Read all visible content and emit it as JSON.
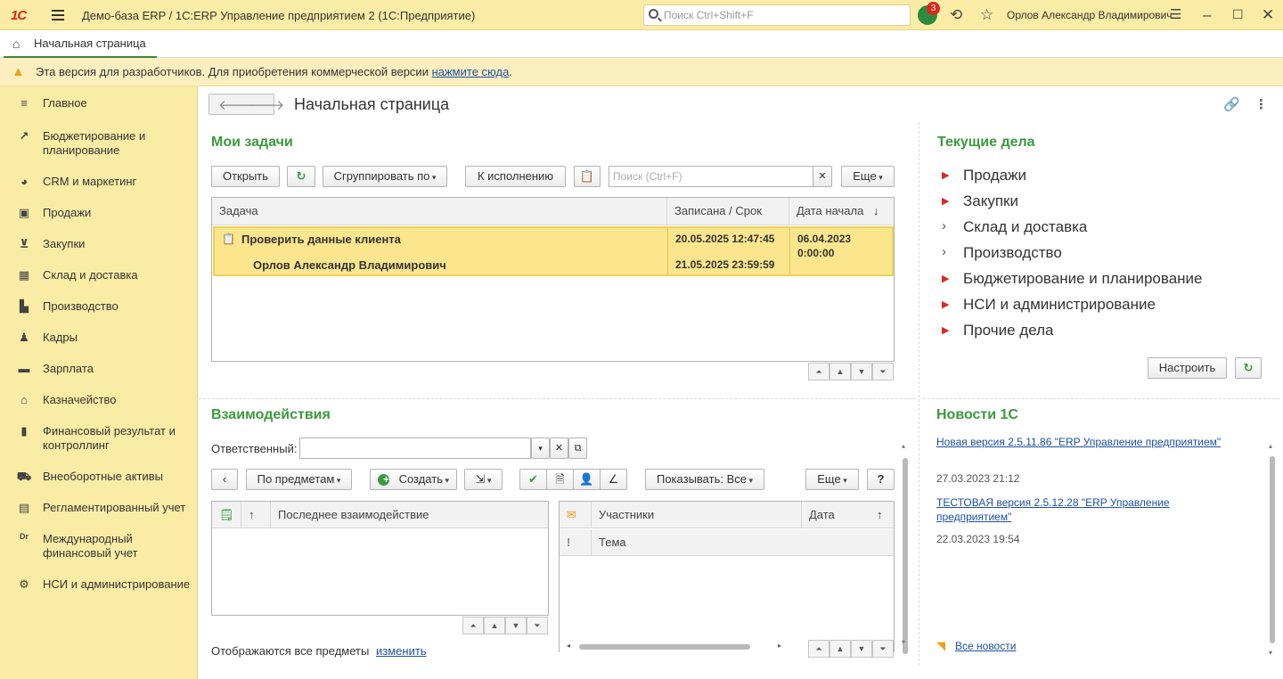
{
  "titlebar": {
    "logo": "1С",
    "title": "Демо-база ERP / 1С:ERP Управление предприятием 2  (1С:Предприятие)",
    "search_placeholder": "Поиск Ctrl+Shift+F",
    "notifications_count": "3",
    "user": "Орлов Александр Владимирович"
  },
  "tabs": [
    {
      "label": "Начальная страница"
    }
  ],
  "warning": {
    "text": "Эта версия для разработчиков. Для приобретения коммерческой версии ",
    "link": "нажмите сюда",
    "suffix": "."
  },
  "sidebar": {
    "items": [
      {
        "label": "Главное",
        "icon": "menu-icon"
      },
      {
        "label": "Бюджетирование и планирование",
        "icon": "chart-icon"
      },
      {
        "label": "CRM и маркетинг",
        "icon": "pie-icon"
      },
      {
        "label": "Продажи",
        "icon": "bag-icon"
      },
      {
        "label": "Закупки",
        "icon": "cart-icon"
      },
      {
        "label": "Склад и доставка",
        "icon": "warehouse-icon"
      },
      {
        "label": "Производство",
        "icon": "factory-icon"
      },
      {
        "label": "Кадры",
        "icon": "person-icon"
      },
      {
        "label": "Зарплата",
        "icon": "money-icon"
      },
      {
        "label": "Казначейство",
        "icon": "treasury-icon"
      },
      {
        "label": "Финансовый результат и контроллинг",
        "icon": "bars-icon"
      },
      {
        "label": "Внеоборотные активы",
        "icon": "car-icon"
      },
      {
        "label": "Регламентированный учет",
        "icon": "calculator-icon"
      },
      {
        "label": "Международный финансовый учет",
        "icon": "drcr-icon"
      },
      {
        "label": "НСИ и администрирование",
        "icon": "gear-icon"
      }
    ]
  },
  "page": {
    "title": "Начальная страница"
  },
  "tasks": {
    "title": "Мои задачи",
    "btn_open": "Открыть",
    "btn_group": "Сгруппировать по",
    "btn_exec": "К исполнению",
    "search_placeholder": "Поиск (Ctrl+F)",
    "btn_more": "Еще",
    "columns": [
      "Задача",
      "Записана / Срок",
      "Дата начала"
    ],
    "row": {
      "task": "Проверить данные клиента",
      "author": "Орлов Александр Владимирович",
      "recorded": "20.05.2025 12:47:45",
      "deadline": "21.05.2025 23:59:59",
      "start_date": "06.04.2023",
      "start_time": "0:00:00"
    }
  },
  "current": {
    "title": "Текущие дела",
    "items": [
      {
        "label": "Продажи",
        "accent": true
      },
      {
        "label": "Закупки",
        "accent": true
      },
      {
        "label": "Склад и доставка",
        "accent": false
      },
      {
        "label": "Производство",
        "accent": false
      },
      {
        "label": "Бюджетирование и планирование",
        "accent": true
      },
      {
        "label": "НСИ и администрирование",
        "accent": true
      },
      {
        "label": "Прочие дела",
        "accent": true
      }
    ],
    "btn_setup": "Настроить"
  },
  "interactions": {
    "title": "Взаимодействия",
    "responsible_label": "Ответственный:",
    "btn_by_subject": "По предметам",
    "btn_create": "Создать",
    "btn_show": "Показывать: Все",
    "btn_more": "Еще",
    "btn_help": "?",
    "left_col": "Последнее взаимодействие",
    "right_cols": [
      "Участники",
      "Дата"
    ],
    "subject_col": "Тема",
    "footer_text": "Отображаются все предметы",
    "footer_link": "изменить"
  },
  "news": {
    "title": "Новости 1С",
    "items": [
      {
        "title": "Новая версия 2.5.11.86 \"ERP Управление предприятием\"",
        "date": "27.03.2023 21:12"
      },
      {
        "title": "ТЕСТОВАЯ версия 2.5.12.28 \"ERP Управление предприятием\"",
        "date": "22.03.2023 19:54"
      }
    ],
    "all_link": "Все новости"
  },
  "colors": {
    "accent_green": "#3b9a3e",
    "panel_yellow": "#fbeca5",
    "link_blue": "#1f4fa3",
    "arrow_red": "#d8281c"
  }
}
